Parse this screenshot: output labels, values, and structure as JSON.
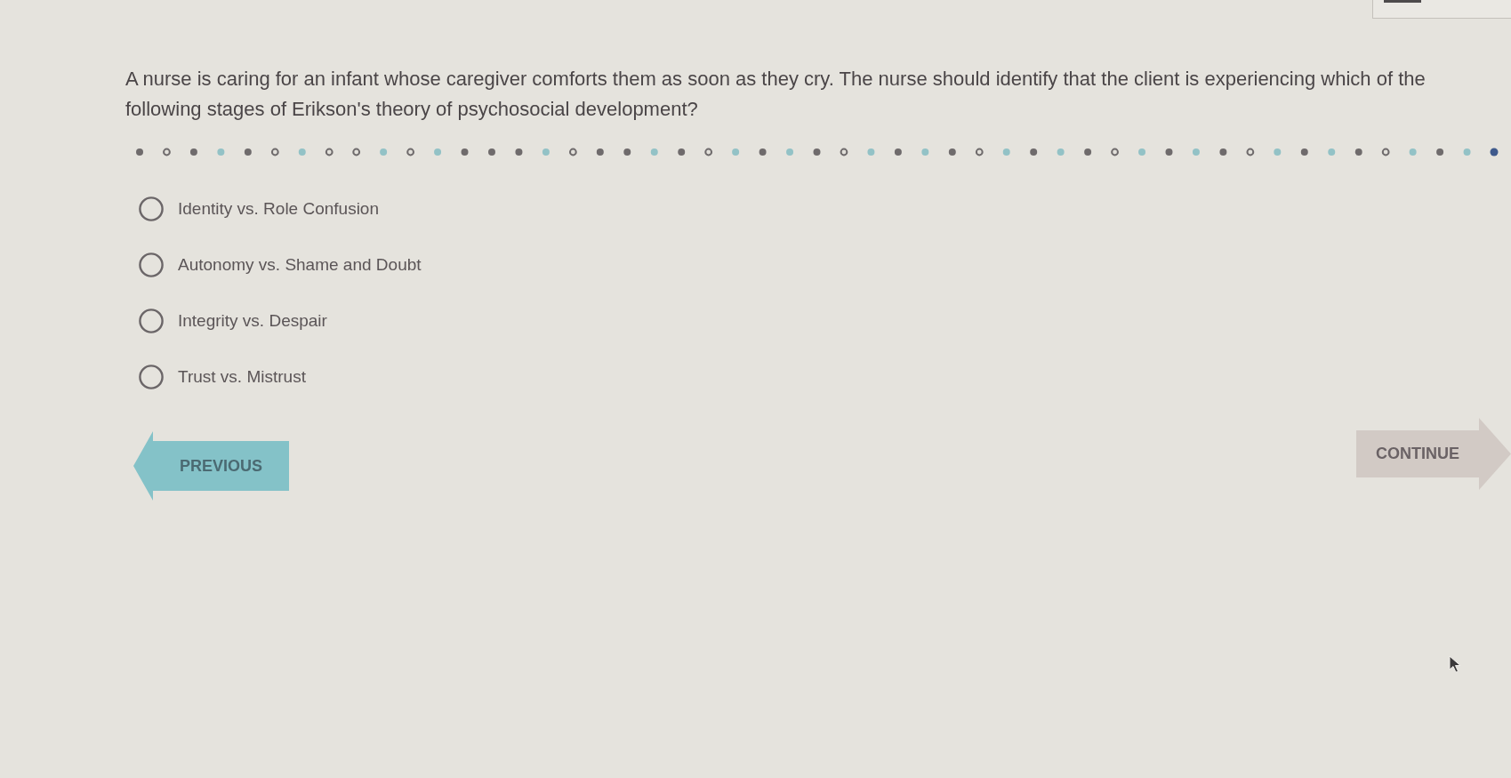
{
  "question": {
    "text": "A nurse is caring for an infant whose caregiver comforts them as soon as they cry. The nurse should identify that the client is experiencing which of the following stages of Erikson's theory of psychosocial development?"
  },
  "options": [
    {
      "label": "Identity vs. Role Confusion",
      "selected": false
    },
    {
      "label": "Autonomy vs. Shame and Doubt",
      "selected": false
    },
    {
      "label": "Integrity vs. Despair",
      "selected": false
    },
    {
      "label": "Trust vs. Mistrust",
      "selected": false
    }
  ],
  "buttons": [
    {
      "kind": "previous",
      "label": "PREVIOUS",
      "disabled": false
    },
    {
      "kind": "continue",
      "label": "CONTINUE",
      "disabled": true
    }
  ]
}
